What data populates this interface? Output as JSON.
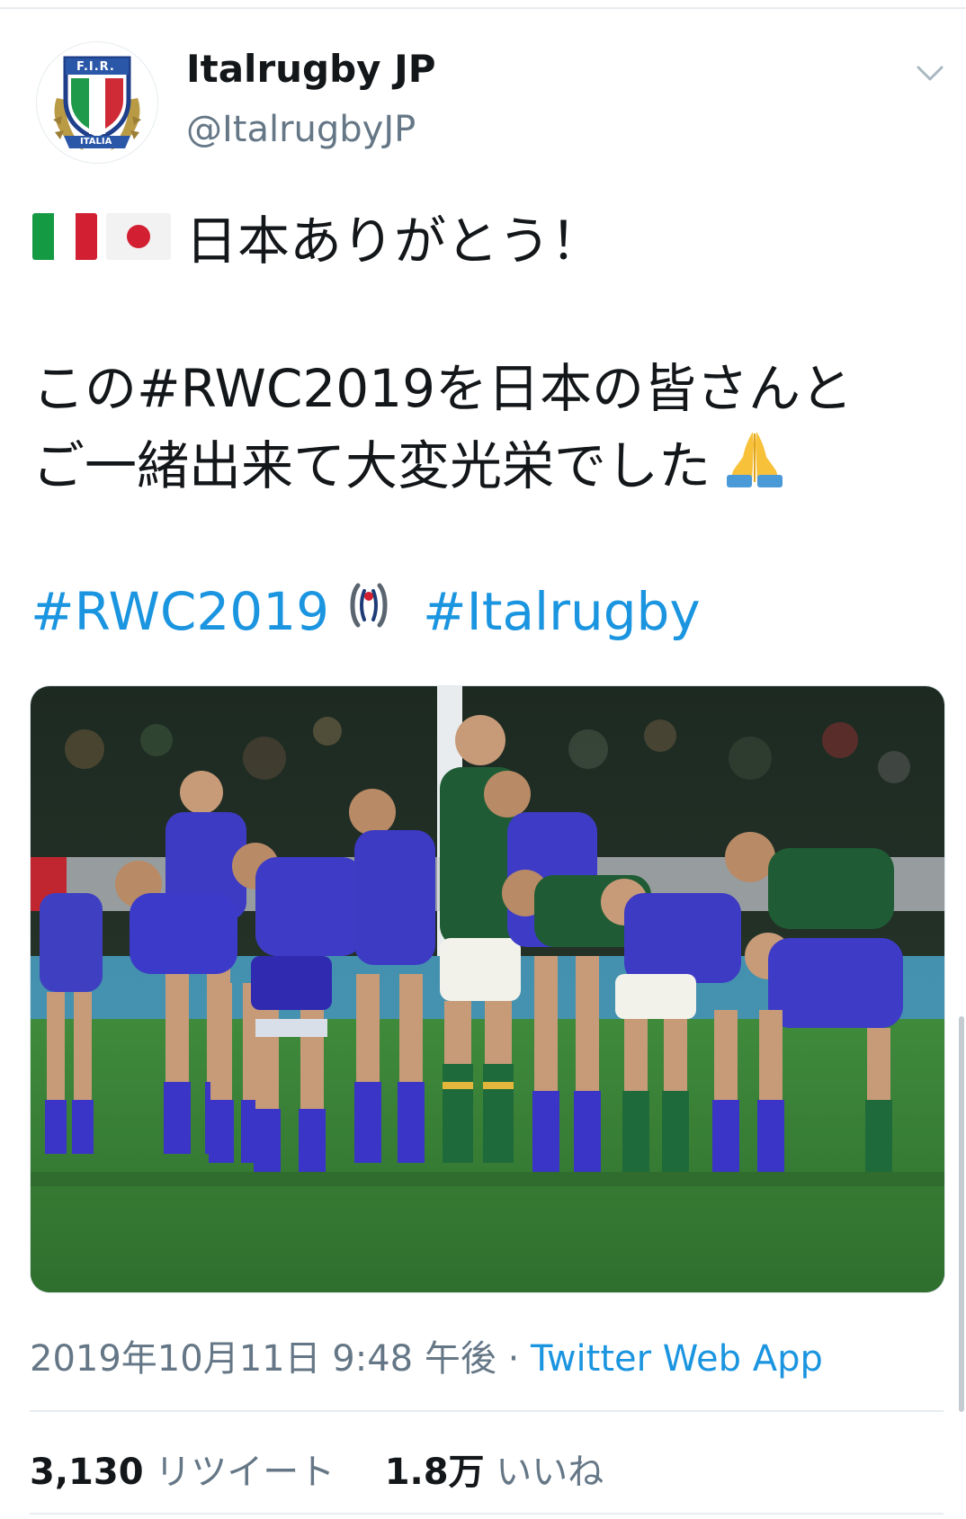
{
  "tweet": {
    "author_name": "Italrugby JP",
    "author_handle": "@ItalrugbyJP",
    "avatar_logo_text": "F.I.R.",
    "avatar_banner_text": "ITALIA",
    "line1": "日本ありがとう！",
    "para_line1": "この#RWC2019を日本の皆さんと",
    "para_line2": "ご一緒出来て大変光栄でした",
    "hashtag1": "#RWC2019",
    "hashtag2": "#Italrugby",
    "timestamp": "2019年10月11日 9:48 午後",
    "separator": " · ",
    "source_app": "Twitter Web App",
    "retweet_count": "3,130",
    "retweet_label": "リツイート",
    "like_count": "1.8万",
    "like_label": "いいね"
  },
  "icons": {
    "menu": "chevron-down-icon",
    "flag1": "italy-flag-icon",
    "flag2": "japan-flag-icon",
    "emoji": "folded-hands-icon",
    "tag_logo": "rwc-logo-icon"
  },
  "colors": {
    "link": "#1b95e0",
    "text": "#14171a",
    "secondary": "#657786",
    "divider": "#e6ecf0"
  }
}
